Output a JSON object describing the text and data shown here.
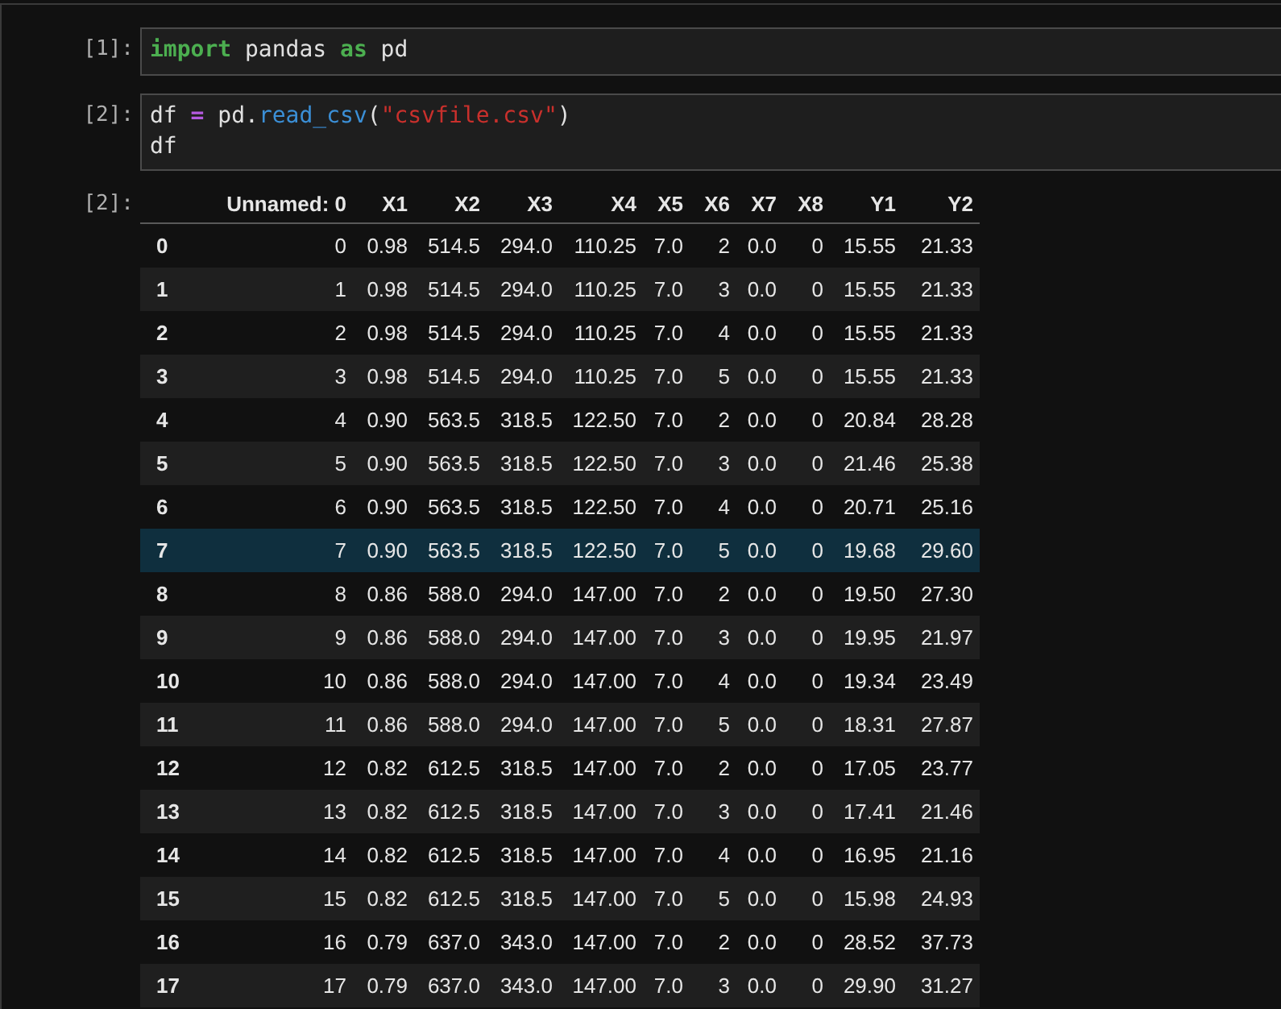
{
  "cells": [
    {
      "prompt": "[1]:",
      "lines": [
        [
          {
            "kind": "keyword",
            "text": "import"
          },
          {
            "kind": "plain",
            "text": " pandas "
          },
          {
            "kind": "keyword",
            "text": "as"
          },
          {
            "kind": "plain",
            "text": " pd"
          }
        ]
      ]
    },
    {
      "prompt": "[2]:",
      "lines": [
        [
          {
            "kind": "plain",
            "text": "df "
          },
          {
            "kind": "operator",
            "text": "="
          },
          {
            "kind": "plain",
            "text": " pd."
          },
          {
            "kind": "function",
            "text": "read_csv"
          },
          {
            "kind": "plain",
            "text": "("
          },
          {
            "kind": "string",
            "text": "\"csvfile.csv\""
          },
          {
            "kind": "plain",
            "text": ")"
          }
        ],
        [
          {
            "kind": "plain",
            "text": "df"
          }
        ]
      ]
    }
  ],
  "output": {
    "prompt": "[2]:",
    "table": {
      "columns": [
        "",
        "Unnamed: 0",
        "X1",
        "X2",
        "X3",
        "X4",
        "X5",
        "X6",
        "X7",
        "X8",
        "Y1",
        "Y2"
      ],
      "rows": [
        {
          "selected": false,
          "cells": [
            "0",
            "0",
            "0.98",
            "514.5",
            "294.0",
            "110.25",
            "7.0",
            "2",
            "0.0",
            "0",
            "15.55",
            "21.33"
          ]
        },
        {
          "selected": false,
          "cells": [
            "1",
            "1",
            "0.98",
            "514.5",
            "294.0",
            "110.25",
            "7.0",
            "3",
            "0.0",
            "0",
            "15.55",
            "21.33"
          ]
        },
        {
          "selected": false,
          "cells": [
            "2",
            "2",
            "0.98",
            "514.5",
            "294.0",
            "110.25",
            "7.0",
            "4",
            "0.0",
            "0",
            "15.55",
            "21.33"
          ]
        },
        {
          "selected": false,
          "cells": [
            "3",
            "3",
            "0.98",
            "514.5",
            "294.0",
            "110.25",
            "7.0",
            "5",
            "0.0",
            "0",
            "15.55",
            "21.33"
          ]
        },
        {
          "selected": false,
          "cells": [
            "4",
            "4",
            "0.90",
            "563.5",
            "318.5",
            "122.50",
            "7.0",
            "2",
            "0.0",
            "0",
            "20.84",
            "28.28"
          ]
        },
        {
          "selected": false,
          "cells": [
            "5",
            "5",
            "0.90",
            "563.5",
            "318.5",
            "122.50",
            "7.0",
            "3",
            "0.0",
            "0",
            "21.46",
            "25.38"
          ]
        },
        {
          "selected": false,
          "cells": [
            "6",
            "6",
            "0.90",
            "563.5",
            "318.5",
            "122.50",
            "7.0",
            "4",
            "0.0",
            "0",
            "20.71",
            "25.16"
          ]
        },
        {
          "selected": true,
          "cells": [
            "7",
            "7",
            "0.90",
            "563.5",
            "318.5",
            "122.50",
            "7.0",
            "5",
            "0.0",
            "0",
            "19.68",
            "29.60"
          ]
        },
        {
          "selected": false,
          "cells": [
            "8",
            "8",
            "0.86",
            "588.0",
            "294.0",
            "147.00",
            "7.0",
            "2",
            "0.0",
            "0",
            "19.50",
            "27.30"
          ]
        },
        {
          "selected": false,
          "cells": [
            "9",
            "9",
            "0.86",
            "588.0",
            "294.0",
            "147.00",
            "7.0",
            "3",
            "0.0",
            "0",
            "19.95",
            "21.97"
          ]
        },
        {
          "selected": false,
          "cells": [
            "10",
            "10",
            "0.86",
            "588.0",
            "294.0",
            "147.00",
            "7.0",
            "4",
            "0.0",
            "0",
            "19.34",
            "23.49"
          ]
        },
        {
          "selected": false,
          "cells": [
            "11",
            "11",
            "0.86",
            "588.0",
            "294.0",
            "147.00",
            "7.0",
            "5",
            "0.0",
            "0",
            "18.31",
            "27.87"
          ]
        },
        {
          "selected": false,
          "cells": [
            "12",
            "12",
            "0.82",
            "612.5",
            "318.5",
            "147.00",
            "7.0",
            "2",
            "0.0",
            "0",
            "17.05",
            "23.77"
          ]
        },
        {
          "selected": false,
          "cells": [
            "13",
            "13",
            "0.82",
            "612.5",
            "318.5",
            "147.00",
            "7.0",
            "3",
            "0.0",
            "0",
            "17.41",
            "21.46"
          ]
        },
        {
          "selected": false,
          "cells": [
            "14",
            "14",
            "0.82",
            "612.5",
            "318.5",
            "147.00",
            "7.0",
            "4",
            "0.0",
            "0",
            "16.95",
            "21.16"
          ]
        },
        {
          "selected": false,
          "cells": [
            "15",
            "15",
            "0.82",
            "612.5",
            "318.5",
            "147.00",
            "7.0",
            "5",
            "0.0",
            "0",
            "15.98",
            "24.93"
          ]
        },
        {
          "selected": false,
          "cells": [
            "16",
            "16",
            "0.79",
            "637.0",
            "343.0",
            "147.00",
            "7.0",
            "2",
            "0.0",
            "0",
            "28.52",
            "37.73"
          ]
        },
        {
          "selected": false,
          "cells": [
            "17",
            "17",
            "0.79",
            "637.0",
            "343.0",
            "147.00",
            "7.0",
            "3",
            "0.0",
            "0",
            "29.90",
            "31.27"
          ]
        }
      ]
    }
  }
}
